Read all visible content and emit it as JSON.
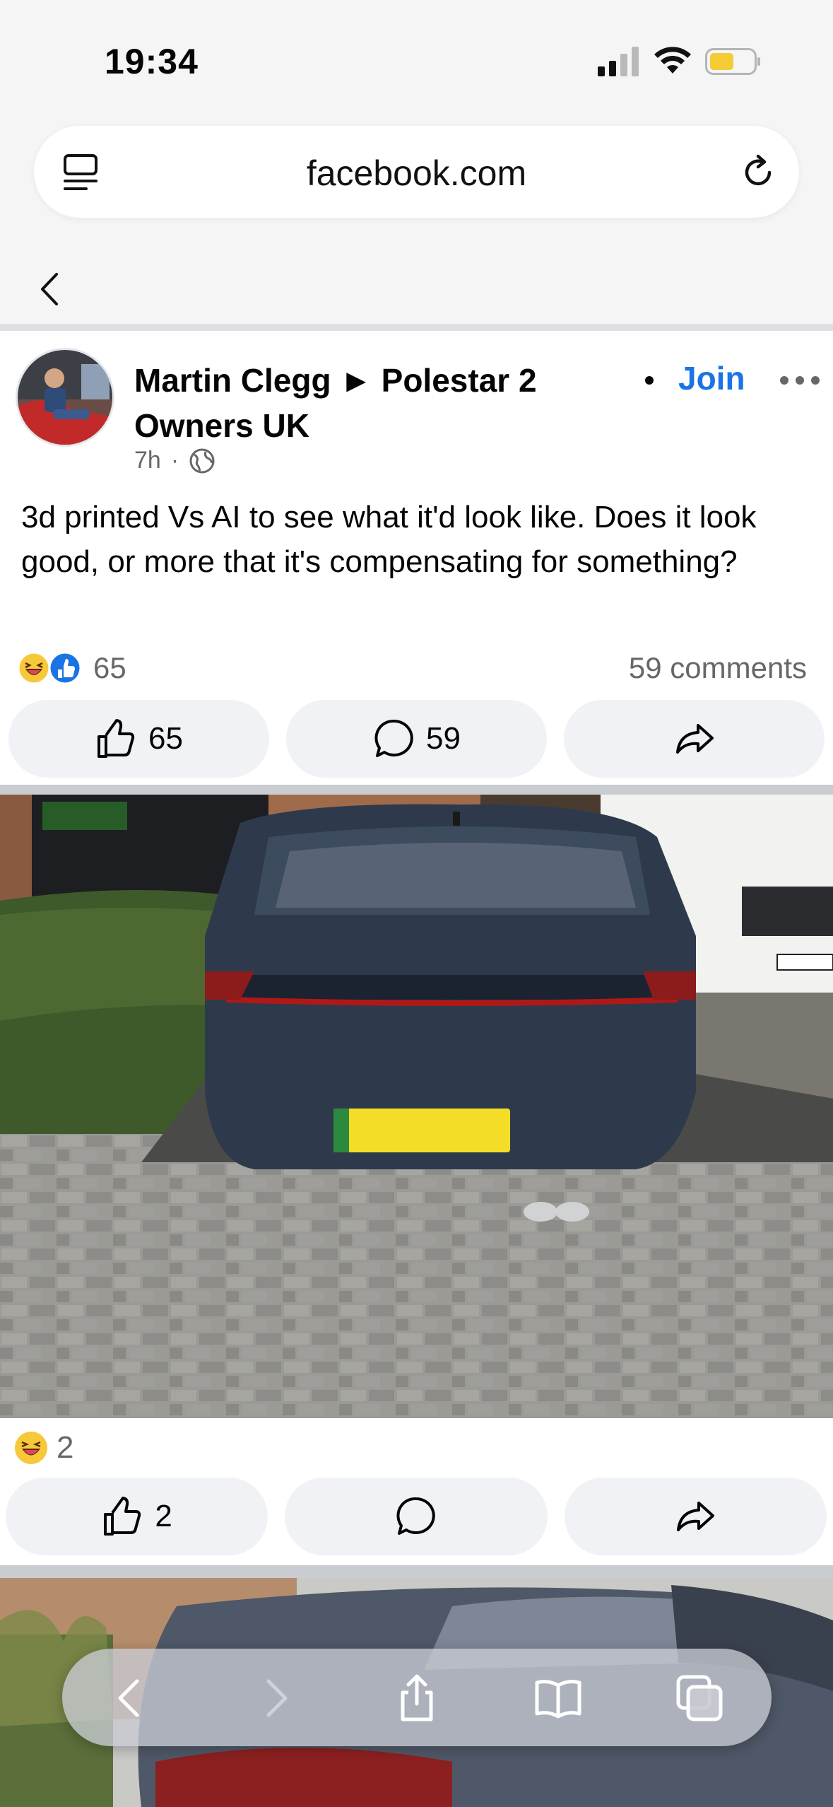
{
  "status_bar": {
    "time": "19:34"
  },
  "browser": {
    "url": "facebook.com"
  },
  "post": {
    "title": "Martin Clegg ► Polestar 2 Owners UK",
    "join_label": "Join",
    "time_ago": "7h",
    "meta_separator": "·",
    "body": "3d printed Vs AI to see what it'd look like.  Does it look good, or more that it's compensating for something?",
    "reaction_count": "65",
    "comments_label": "59 comments",
    "actions": {
      "like_count": "65",
      "comment_count": "59"
    }
  },
  "photo_1": {
    "reaction_count": "2",
    "actions": {
      "like_count": "2"
    }
  },
  "colors": {
    "accent": "#1b74e4",
    "button_bg": "#f0f2f5",
    "meta": "#65676b"
  },
  "icons": [
    "tab-overview-icon",
    "reload-icon",
    "back-chevron-icon",
    "globe-icon",
    "more-icon",
    "like-icon",
    "comment-icon",
    "share-icon",
    "share-sheet-icon",
    "bookmarks-icon",
    "tabs-icon"
  ]
}
